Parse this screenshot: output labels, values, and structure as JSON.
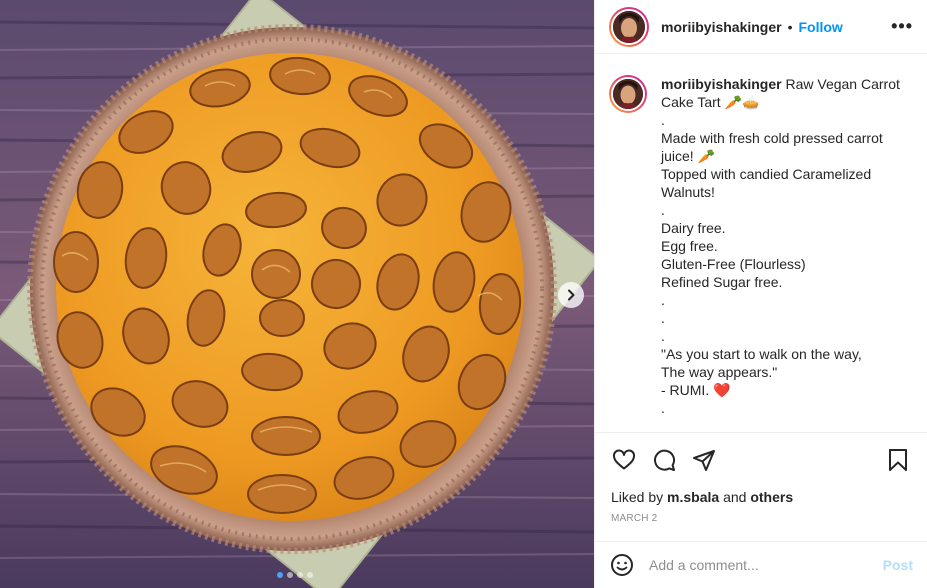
{
  "post": {
    "username": "moriibyishakinger",
    "follow_label": "Follow",
    "separator": "•",
    "more_label": "•••",
    "caption_lines": [
      "Raw Vegan Carrot Cake Tart 🥕🥧",
      ".",
      "Made with fresh cold pressed carrot juice! 🥕",
      "Topped with candied Caramelized Walnuts!",
      ".",
      "Dairy free.",
      "Egg free.",
      "Gluten-Free (Flourless)",
      "Refined Sugar free.",
      ".",
      ".",
      ".",
      "\"As you start to walk on the way,",
      "The way appears.\"",
      "- RUMI. ❤️",
      "."
    ],
    "liked_prefix": "Liked by",
    "liked_user": "m.sbala",
    "liked_and": "and",
    "liked_others": "others",
    "date": "MARCH 2",
    "comment_placeholder": "Add a comment...",
    "post_label": "Post",
    "carousel": {
      "total": 4,
      "active_index": 0
    },
    "colors": {
      "accent": "#0095f6",
      "post_disabled": "#b2dffc",
      "tart_filling": "#f2a22a",
      "walnut": "#c2732a"
    }
  },
  "icons": {
    "like": "heart-icon",
    "comment": "comment-icon",
    "share": "share-icon",
    "save": "bookmark-icon",
    "emoji": "emoji-icon",
    "next": "chevron-right-icon"
  }
}
